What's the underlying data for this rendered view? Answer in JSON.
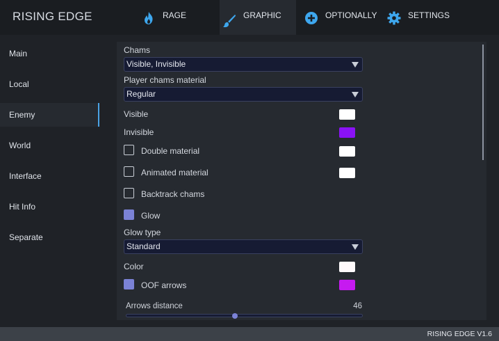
{
  "app": {
    "title": "RISING EDGE",
    "version": "RISING EDGE V1.6"
  },
  "tabs": [
    {
      "label": "RAGE",
      "icon": "flame-icon"
    },
    {
      "label": "GRAPHIC",
      "icon": "brush-icon",
      "active": true
    },
    {
      "label": "OPTIONALLY",
      "icon": "plus-circle-icon"
    },
    {
      "label": "SETTINGS",
      "icon": "gear-icon"
    }
  ],
  "sidebar": {
    "items": [
      {
        "label": "Main"
      },
      {
        "label": "Local"
      },
      {
        "label": "Enemy",
        "active": true
      },
      {
        "label": "World"
      },
      {
        "label": "Interface"
      },
      {
        "label": "Hit Info"
      },
      {
        "label": "Separate"
      }
    ]
  },
  "content": {
    "chams": {
      "label": "Chams",
      "value": "Visible, Invisible"
    },
    "player_material": {
      "label": "Player chams material",
      "value": "Regular"
    },
    "visible": {
      "label": "Visible",
      "color": "#ffffff"
    },
    "invisible": {
      "label": "Invisible",
      "color": "#8a12f5"
    },
    "double_material": {
      "label": "Double material",
      "checked": false,
      "color": "#ffffff"
    },
    "animated_material": {
      "label": "Animated material",
      "checked": false,
      "color": "#ffffff"
    },
    "backtrack_chams": {
      "label": "Backtrack chams",
      "checked": false
    },
    "glow": {
      "label": "Glow",
      "checked": true
    },
    "glow_type": {
      "label": "Glow type",
      "value": "Standard"
    },
    "glow_color": {
      "label": "Color",
      "color": "#fffafc"
    },
    "oof_arrows": {
      "label": "OOF arrows",
      "checked": true,
      "color": "#c61af0"
    },
    "arrows_distance": {
      "label": "Arrows distance",
      "value": "46",
      "fraction": 0.46
    }
  },
  "colors": {
    "accent": "#4aa3e6",
    "checkbox_on": "#7b82d6",
    "select_bg": "#161b33"
  }
}
